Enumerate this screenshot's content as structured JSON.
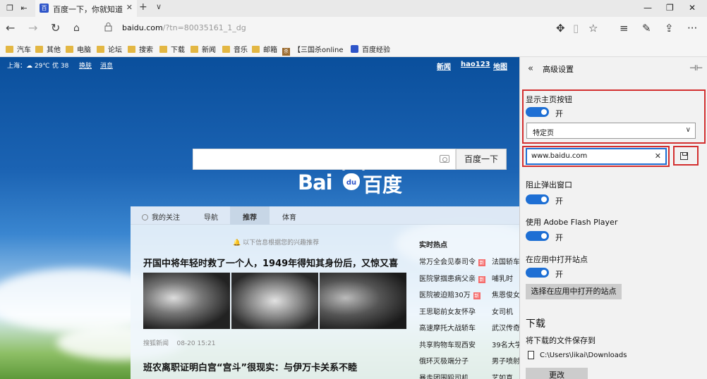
{
  "tab": {
    "title": "百度一下，你就知道",
    "favicon": "百"
  },
  "address": {
    "host": "baidu.com",
    "path": "/?tn=80035161_1_dg"
  },
  "bookmarks": [
    {
      "label": "汽车",
      "kind": "folder"
    },
    {
      "label": "其他",
      "kind": "folder"
    },
    {
      "label": "电脑",
      "kind": "folder"
    },
    {
      "label": "论坛",
      "kind": "folder"
    },
    {
      "label": "搜索",
      "kind": "folder"
    },
    {
      "label": "下载",
      "kind": "folder"
    },
    {
      "label": "新闻",
      "kind": "folder"
    },
    {
      "label": "音乐",
      "kind": "folder"
    },
    {
      "label": "邮箱",
      "kind": "folder"
    },
    {
      "label": "【三国杀online",
      "kind": "site",
      "badge": "杀"
    },
    {
      "label": "百度经验",
      "kind": "site"
    }
  ],
  "top": {
    "weather": "上海：☁ 29℃",
    "aq": "优 38",
    "skin": "换肤",
    "msg": "消息",
    "links": [
      "新闻",
      "hao123",
      "地图"
    ]
  },
  "logo": {
    "latin": "Bai",
    "mark": "du",
    "cn": "百度"
  },
  "search": {
    "button": "百度一下"
  },
  "feed": {
    "tabs": [
      "我的关注",
      "导航",
      "推荐",
      "体育"
    ],
    "hint": "以下信息根据您的兴趣推荐",
    "headline": "开国中将年轻时救了一个人，1949年得知其身份后，又惊又喜",
    "source": "搜狐新闻",
    "time": "08-20 15:21",
    "headline2": "班农离职证明白宫“宫斗”很现实：与伊万卡关系不睦",
    "hot_title": "实时热点",
    "hot_left": [
      "常万全会见泰司令",
      "医院掌掴患病父亲",
      "医院被迫赔30万",
      "王思聪前女友怀孕",
      "高速摩托大战轿车",
      "共享购物车现西安",
      "俄环灭极端分子",
      "暴走团围殴司机"
    ],
    "hot_left_new": [
      true,
      true,
      true,
      false,
      false,
      false,
      false,
      false
    ],
    "hot_right": [
      "法国轿车",
      "哺乳时",
      "焦恩俊女",
      "女司机",
      "武汉传奇",
      "39名大学",
      "男子喷射",
      "艺如真"
    ]
  },
  "panel": {
    "title": "高级设置",
    "home_button_label": "显示主页按钮",
    "on": "开",
    "home_select": "特定页",
    "home_url": "www.baidu.com",
    "popup_label": "阻止弹出窗口",
    "flash_label": "使用 Adobe Flash Player",
    "app_label": "在应用中打开站点",
    "app_button": "选择在应用中打开的站点",
    "download_title": "下载",
    "download_label": "将下载的文件保存到",
    "download_path": "C:\\Users\\likai\\Downloads",
    "change_button": "更改"
  }
}
